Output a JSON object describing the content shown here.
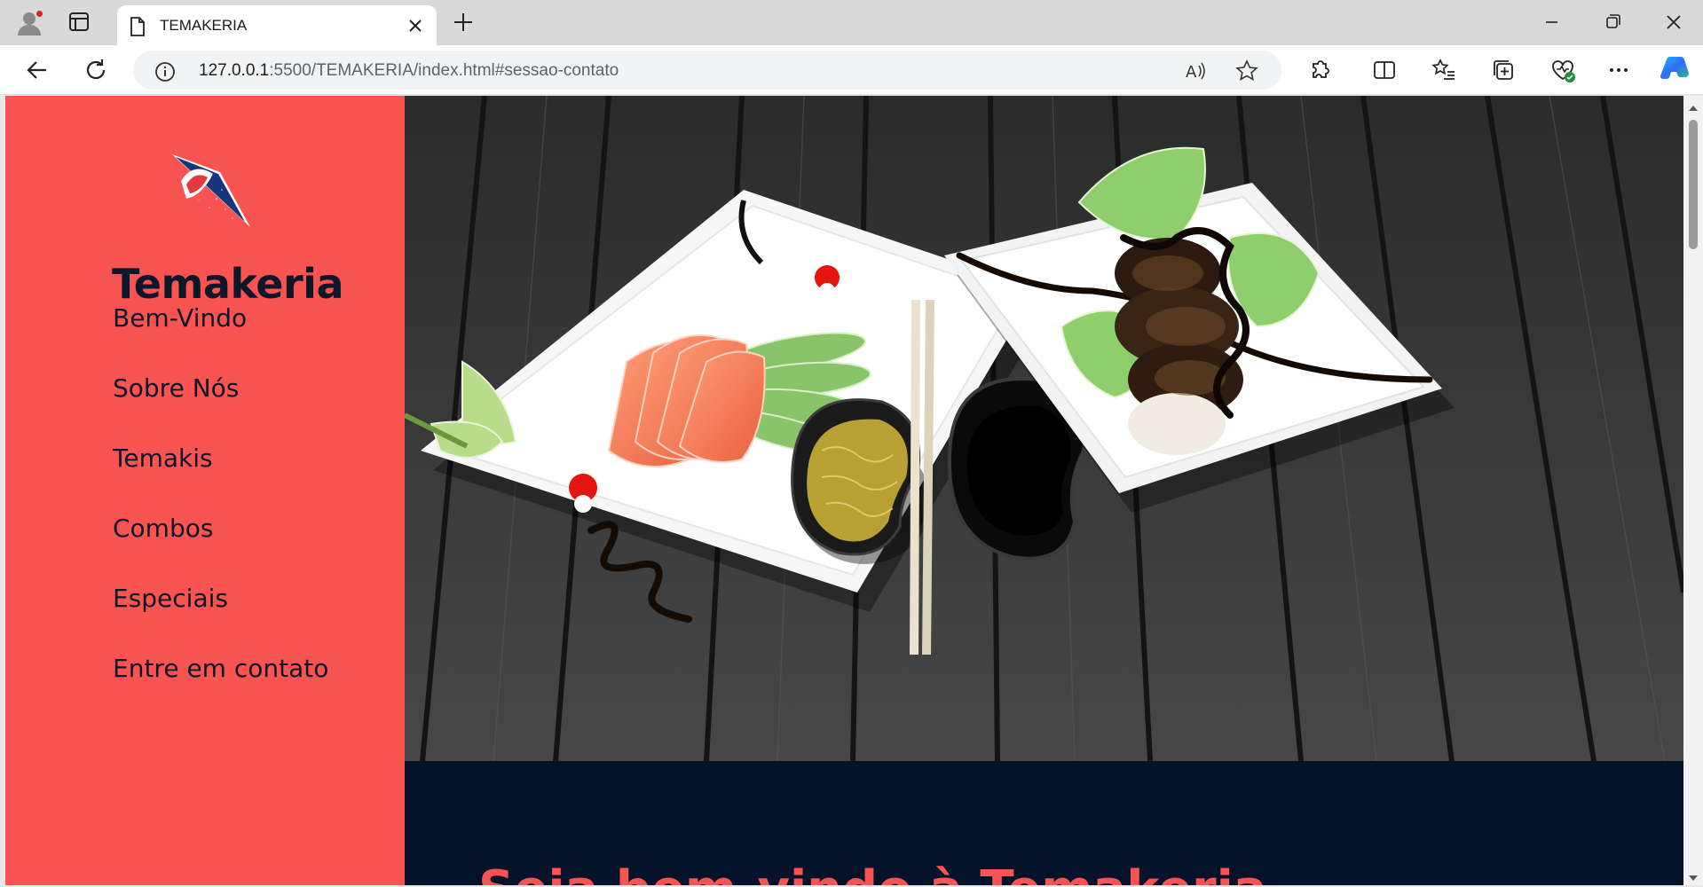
{
  "browser": {
    "tab_title": "TEMAKERIA",
    "url_host": "127.0.0.1",
    "url_rest": ":5500/TEMAKERIA/index.html#sessao-contato"
  },
  "site": {
    "brand": "Temakeria",
    "menu": [
      "Bem-Vindo",
      "Sobre Nós",
      "Temakis",
      "Combos",
      "Especiais",
      "Entre em contato"
    ],
    "welcome_heading": "Seja bem-vindo à Temakeria"
  },
  "colors": {
    "sidebar": "#f95352",
    "navy": "#04132a",
    "accent": "#f95352"
  }
}
